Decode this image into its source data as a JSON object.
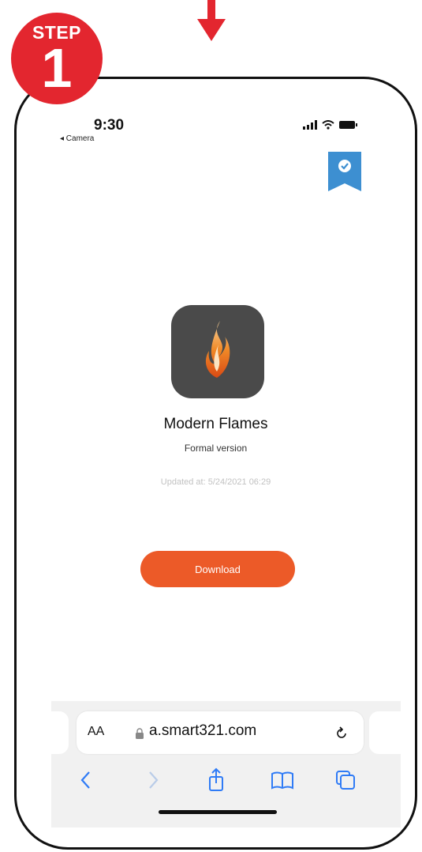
{
  "step": {
    "word": "STEP",
    "number": "1"
  },
  "status_bar": {
    "time": "9:30",
    "back_label": "◂ Camera"
  },
  "app": {
    "name": "Modern Flames",
    "subtitle": "Formal version",
    "updated": "Updated at: 5/24/2021 06:29",
    "download_label": "Download"
  },
  "browser": {
    "text_size_label": "AA",
    "url": "a.smart321.com"
  },
  "icons": {
    "arrow": "down-arrow-icon",
    "bookmark": "verified-ribbon-icon",
    "app": "flame-icon",
    "lock": "lock-icon",
    "reload": "reload-icon",
    "back": "chevron-left-icon",
    "forward": "chevron-right-icon",
    "share": "share-icon",
    "bookmarks": "book-icon",
    "tabs": "tabs-icon"
  },
  "colors": {
    "step_badge": "#e3262f",
    "download_button": "#ec5a28",
    "bookmark_ribbon": "#3d8fd1",
    "ios_blue": "#2f7bf6"
  }
}
